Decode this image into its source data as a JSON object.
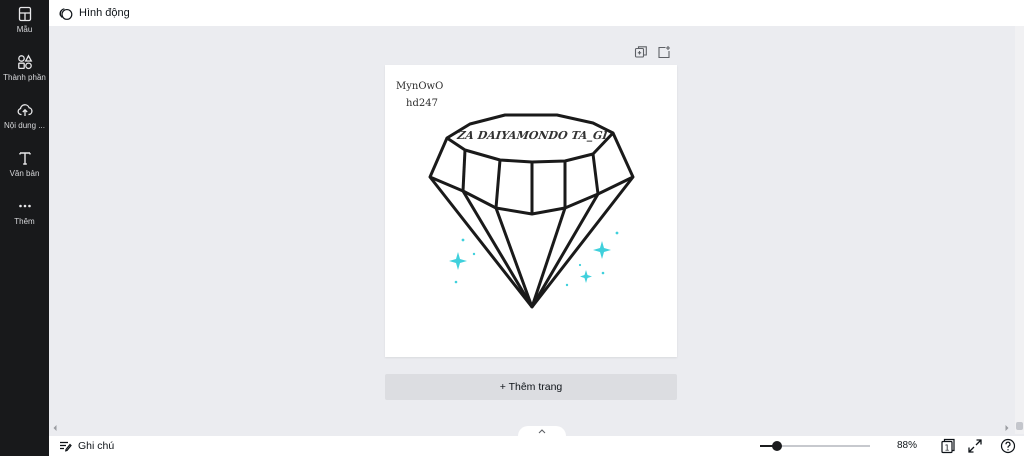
{
  "sidebar": {
    "items": [
      {
        "label": "Mẫu",
        "icon": "template-icon"
      },
      {
        "label": "Thành phần",
        "icon": "elements-icon"
      },
      {
        "label": "Nội dung ...",
        "icon": "upload-icon"
      },
      {
        "label": "Văn bản",
        "icon": "text-icon"
      },
      {
        "label": "Thêm",
        "icon": "more-icon"
      }
    ]
  },
  "toolbar": {
    "animate_label": "Hình động"
  },
  "page": {
    "text_line1": "MynOwO",
    "text_line2": "hd247",
    "diamond_banner": "ZA DAIYAMONDO TA_GI",
    "accent_color": "#3fd0dc"
  },
  "add_page_label": "+ Thêm trang",
  "bottombar": {
    "notes_label": "Ghi chú",
    "zoom_text": "88%",
    "zoom_level": 88,
    "page_count": "1"
  }
}
